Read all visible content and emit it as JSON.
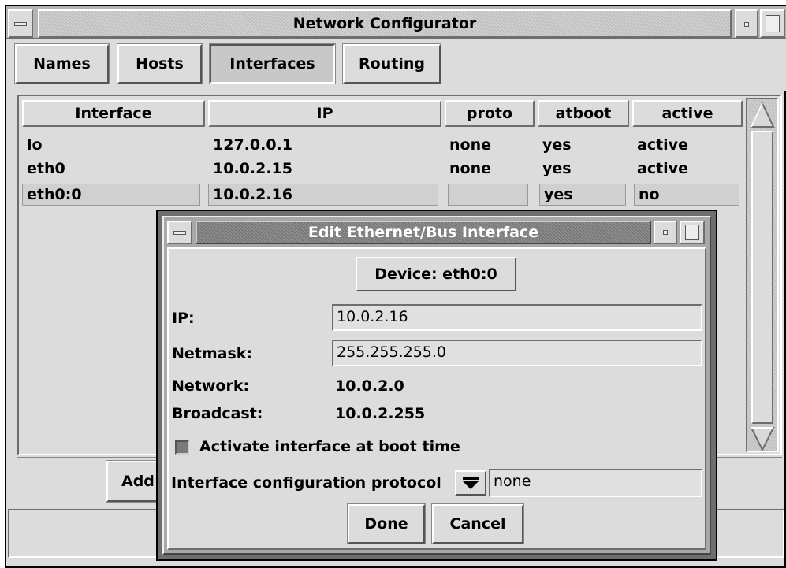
{
  "main_window": {
    "title": "Network Configurator",
    "tabs": [
      {
        "label": "Names"
      },
      {
        "label": "Hosts"
      },
      {
        "label": "Interfaces"
      },
      {
        "label": "Routing"
      }
    ],
    "table": {
      "columns": [
        "Interface",
        "IP",
        "proto",
        "atboot",
        "active"
      ],
      "rows": [
        {
          "interface": "lo",
          "ip": "127.0.0.1",
          "proto": "none",
          "atboot": "yes",
          "active": "active"
        },
        {
          "interface": "eth0",
          "ip": "10.0.2.15",
          "proto": "none",
          "atboot": "yes",
          "active": "active"
        },
        {
          "interface": "eth0:0",
          "ip": "10.0.2.16",
          "proto": "",
          "atboot": "yes",
          "active": "no"
        }
      ]
    },
    "add_button": "Add"
  },
  "dialog": {
    "title": "Edit Ethernet/Bus Interface",
    "device_button": "Device: eth0:0",
    "ip_label": "IP:",
    "ip_value": "10.0.2.16",
    "netmask_label": "Netmask:",
    "netmask_value": "255.255.255.0",
    "network_label": "Network:",
    "network_value": "10.0.2.0",
    "broadcast_label": "Broadcast:",
    "broadcast_value": "10.0.2.255",
    "activate_label": "Activate interface at boot time",
    "activate_checked": true,
    "protocol_label": "Interface configuration protocol",
    "protocol_value": "none",
    "done_button": "Done",
    "cancel_button": "Cancel"
  }
}
